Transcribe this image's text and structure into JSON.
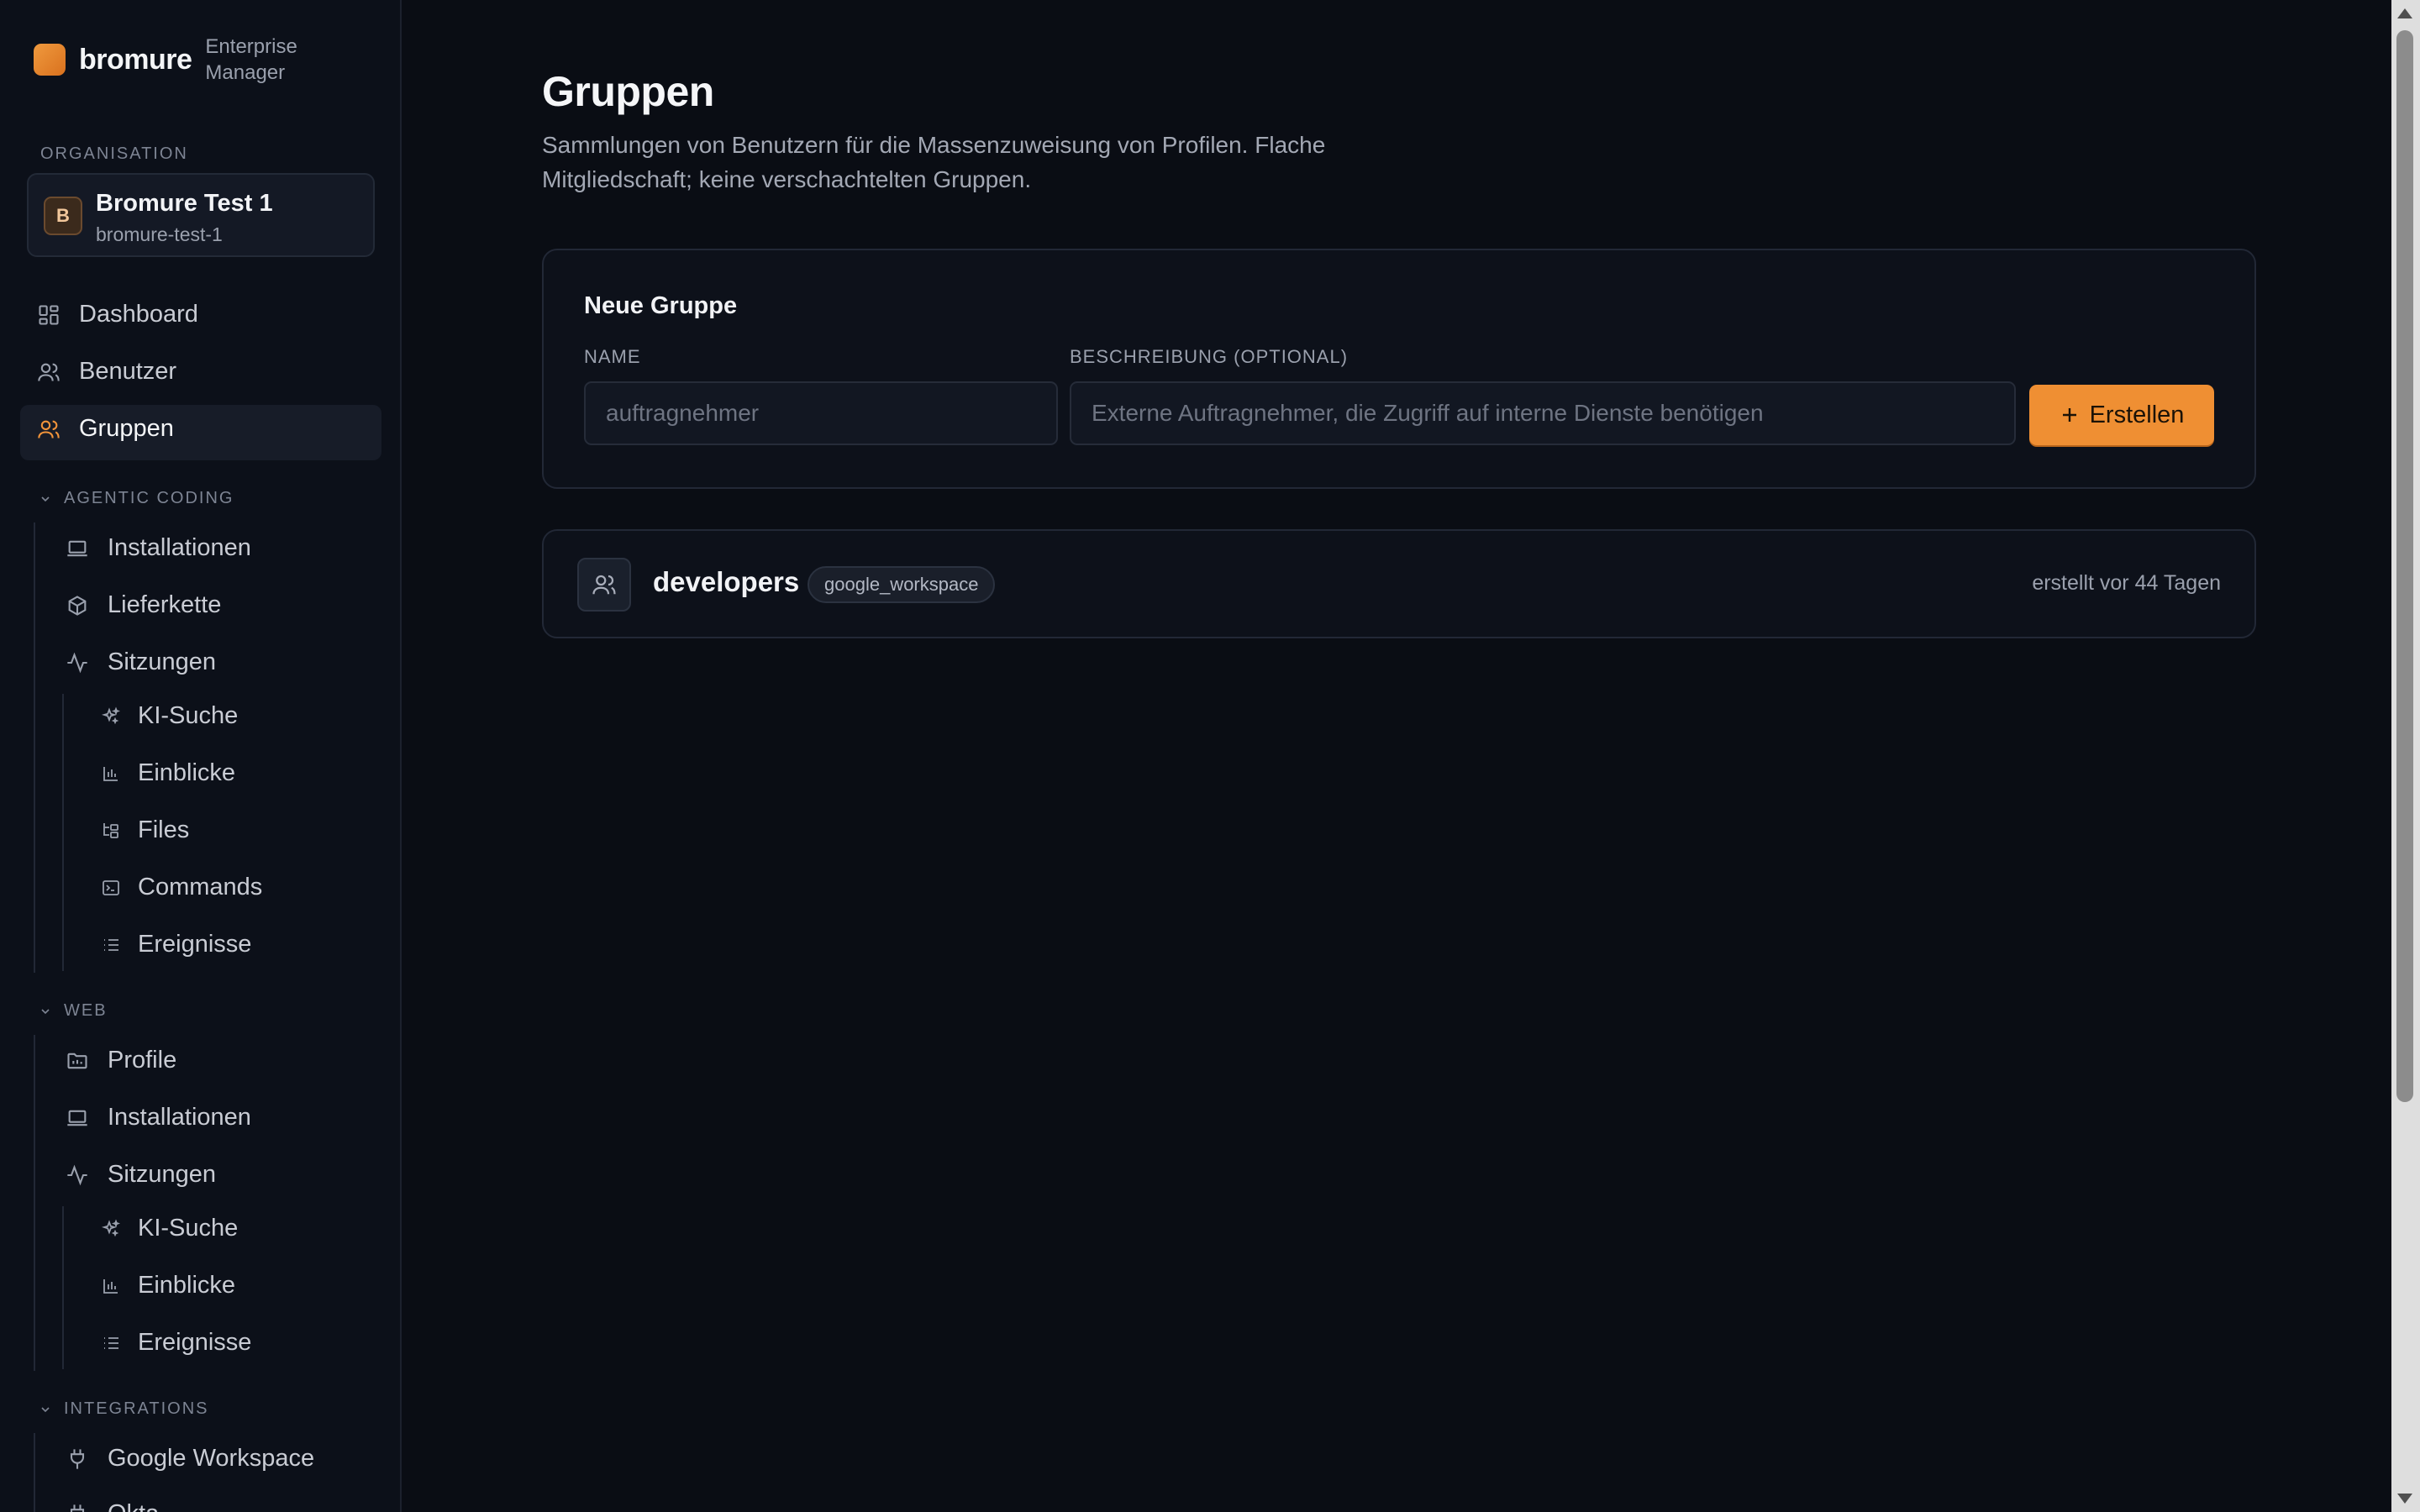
{
  "brand": {
    "name": "bromure",
    "subtitle": "Enterprise Manager"
  },
  "organisation": {
    "caption": "ORGANISATION",
    "avatar": "B",
    "name": "Bromure Test 1",
    "slug": "bromure-test-1"
  },
  "nav": {
    "dashboard": "Dashboard",
    "benutzer": "Benutzer",
    "gruppen": "Gruppen"
  },
  "agentic": {
    "header": "AGENTIC CODING",
    "installationen": "Installationen",
    "lieferkette": "Lieferkette",
    "sitzungen": "Sitzungen",
    "ki_suche": "KI-Suche",
    "einblicke": "Einblicke",
    "files": "Files",
    "commands": "Commands",
    "ereignisse": "Ereignisse"
  },
  "web": {
    "header": "WEB",
    "profile": "Profile",
    "installationen": "Installationen",
    "sitzungen": "Sitzungen",
    "ki_suche": "KI-Suche",
    "einblicke": "Einblicke",
    "ereignisse": "Ereignisse"
  },
  "integrations": {
    "header": "INTEGRATIONS",
    "google_workspace": "Google Workspace",
    "next_partial": "Okta"
  },
  "page": {
    "title": "Gruppen",
    "description": "Sammlungen von Benutzern für die Massenzuweisung von Profilen. Flache Mitgliedschaft; keine verschachtelten Gruppen."
  },
  "form": {
    "title": "Neue Gruppe",
    "name_label": "NAME",
    "name_placeholder": "auftragnehmer",
    "desc_label": "BESCHREIBUNG (OPTIONAL)",
    "desc_placeholder": "Externe Auftragnehmer, die Zugriff auf interne Dienste benötigen",
    "create_label": "Erstellen"
  },
  "groups": [
    {
      "name": "developers",
      "source": "google_workspace",
      "created": "erstellt vor 44 Tagen"
    }
  ],
  "colors": {
    "accent": "#ef8f33",
    "background": "#0a0d14",
    "sidebar": "#0c1019"
  }
}
